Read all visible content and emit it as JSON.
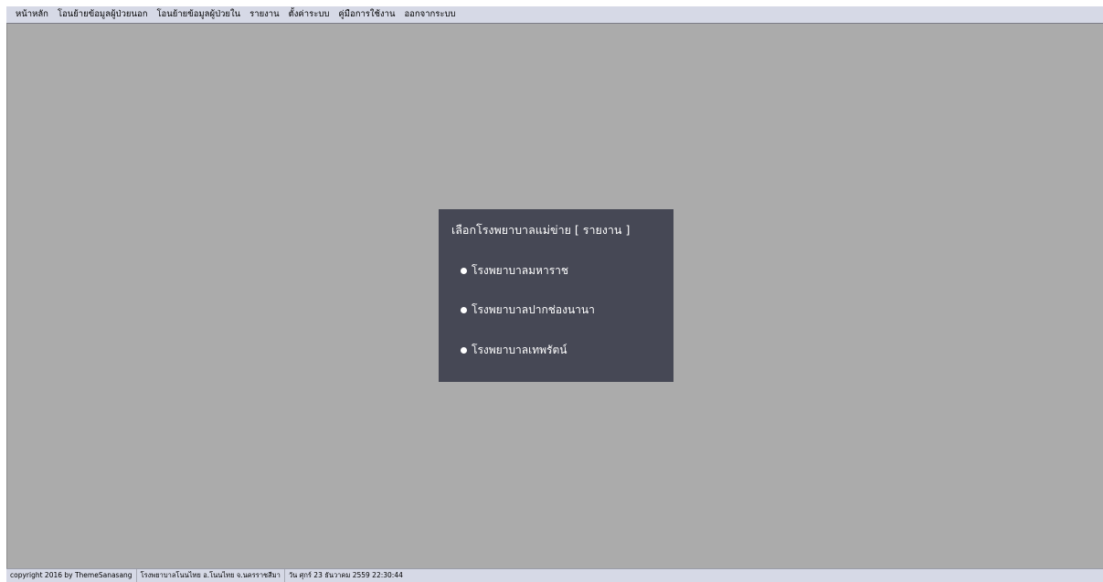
{
  "menu": {
    "items": [
      "หน้าหลัก",
      "โอนย้ายข้อมูลผู้ป่วยนอก",
      "โอนย้ายข้อมูลผู้ป่วยใน",
      "รายงาน",
      "ตั้งค่าระบบ",
      "คู่มือการใช้งาน",
      "ออกจากระบบ"
    ]
  },
  "dialog": {
    "title": "เลือกโรงพยาบาลแม่ข่าย [ รายงาน ]",
    "options": [
      "โรงพยาบาลมหาราช",
      "โรงพยาบาลปากช่องนานา",
      "โรงพยาบาลเทพรัตน์"
    ]
  },
  "status": {
    "copyright": "copyright 2016 by ThemeSanasang",
    "hospital": "โรงพยาบาลโนนไทย อ.โนนไทย จ.นครราชสีมา",
    "datetime": "วัน ศุกร์ 23 ธันวาคม 2559 22:30:44"
  },
  "colors": {
    "workspace": "#ababab",
    "menubar": "#d6d9e6",
    "dialog": "#464855",
    "text_light": "#ffffff"
  },
  "icons": {
    "option_bullet": "bullet-icon"
  }
}
